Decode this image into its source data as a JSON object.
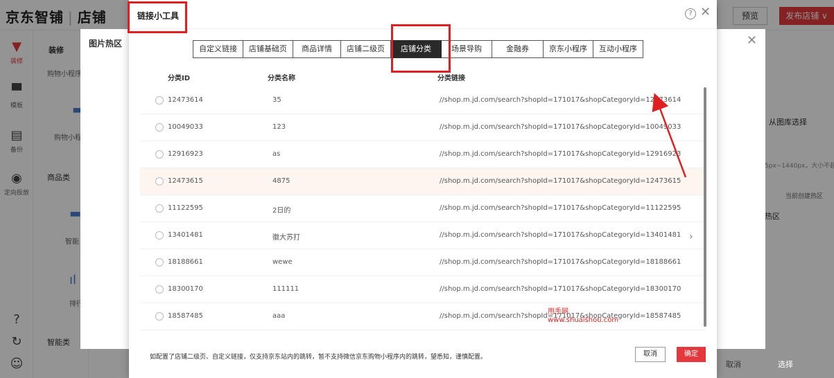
{
  "app": {
    "logo_left": "京东智铺",
    "logo_sep": "|",
    "logo_right": "店铺",
    "preview": "预览",
    "publish": "发布店铺 ∨"
  },
  "leftnav": [
    {
      "label": "装修",
      "icon": "paint-roller-icon"
    },
    {
      "label": "模板",
      "icon": "shirt-icon"
    },
    {
      "label": "备份",
      "icon": "backup-icon"
    },
    {
      "label": "定向投放",
      "icon": "target-icon"
    }
  ],
  "panel2": {
    "header": "装修",
    "item1": "购物小程序",
    "item2": "购物小程",
    "cat1": "商品类",
    "item3": "智能",
    "item4": "排行",
    "cat2": "智能类"
  },
  "behind_dialog": {
    "title": "图片热区",
    "from_lib": "从图库选择",
    "size_hint": "5px~1440px，大小不超",
    "hot_count": "当前创建热区",
    "hot_label": "热区",
    "cancel": "取消",
    "choose": "选择"
  },
  "dialog": {
    "title": "链接小工具",
    "tabs": [
      "自定义链接",
      "店铺基础页",
      "商品详情",
      "店铺二级页",
      "店铺分类",
      "场景导购",
      "金融券",
      "京东小程序",
      "互动小程序"
    ],
    "active_tab": "店铺分类",
    "columns": {
      "id": "分类ID",
      "name": "分类名称",
      "link": "分类链接"
    },
    "rows": [
      {
        "id": "12473614",
        "name": "35",
        "link": "//shop.m.jd.com/search?shopId=171017&shopCategoryId=12473614"
      },
      {
        "id": "10049033",
        "name": "123",
        "link": "//shop.m.jd.com/search?shopId=171017&shopCategoryId=10049033"
      },
      {
        "id": "12916923",
        "name": "as",
        "link": "//shop.m.jd.com/search?shopId=171017&shopCategoryId=12916923"
      },
      {
        "id": "12473615",
        "name": "4875",
        "link": "//shop.m.jd.com/search?shopId=171017&shopCategoryId=12473615"
      },
      {
        "id": "11122595",
        "name": "2日的",
        "link": "//shop.m.jd.com/search?shopId=171017&shopCategoryId=11122595"
      },
      {
        "id": "13401481",
        "name": "徽大苏打",
        "link": "//shop.m.jd.com/search?shopId=171017&shopCategoryId=13401481"
      },
      {
        "id": "18188661",
        "name": "wewe",
        "link": "//shop.m.jd.com/search?shopId=171017&shopCategoryId=18188661"
      },
      {
        "id": "18300170",
        "name": "111111",
        "link": "//shop.m.jd.com/search?shopId=171017&shopCategoryId=18300170"
      },
      {
        "id": "18587485",
        "name": "aaa",
        "link": "//shop.m.jd.com/search?shopId=171017&shopCategoryId=18587485"
      }
    ],
    "footnote": "如配置了店铺二级页、自定义链接，仅支持京东站内的跳转，暂不支持微信京东购物小程序内的跳转，望悉知，谨慎配置。",
    "cancel": "取消",
    "ok": "确定",
    "watermark1": "甩手网",
    "watermark2": "www.shuaishou.com"
  },
  "colors": {
    "accent": "#e4393c",
    "annotation": "#e02020"
  }
}
